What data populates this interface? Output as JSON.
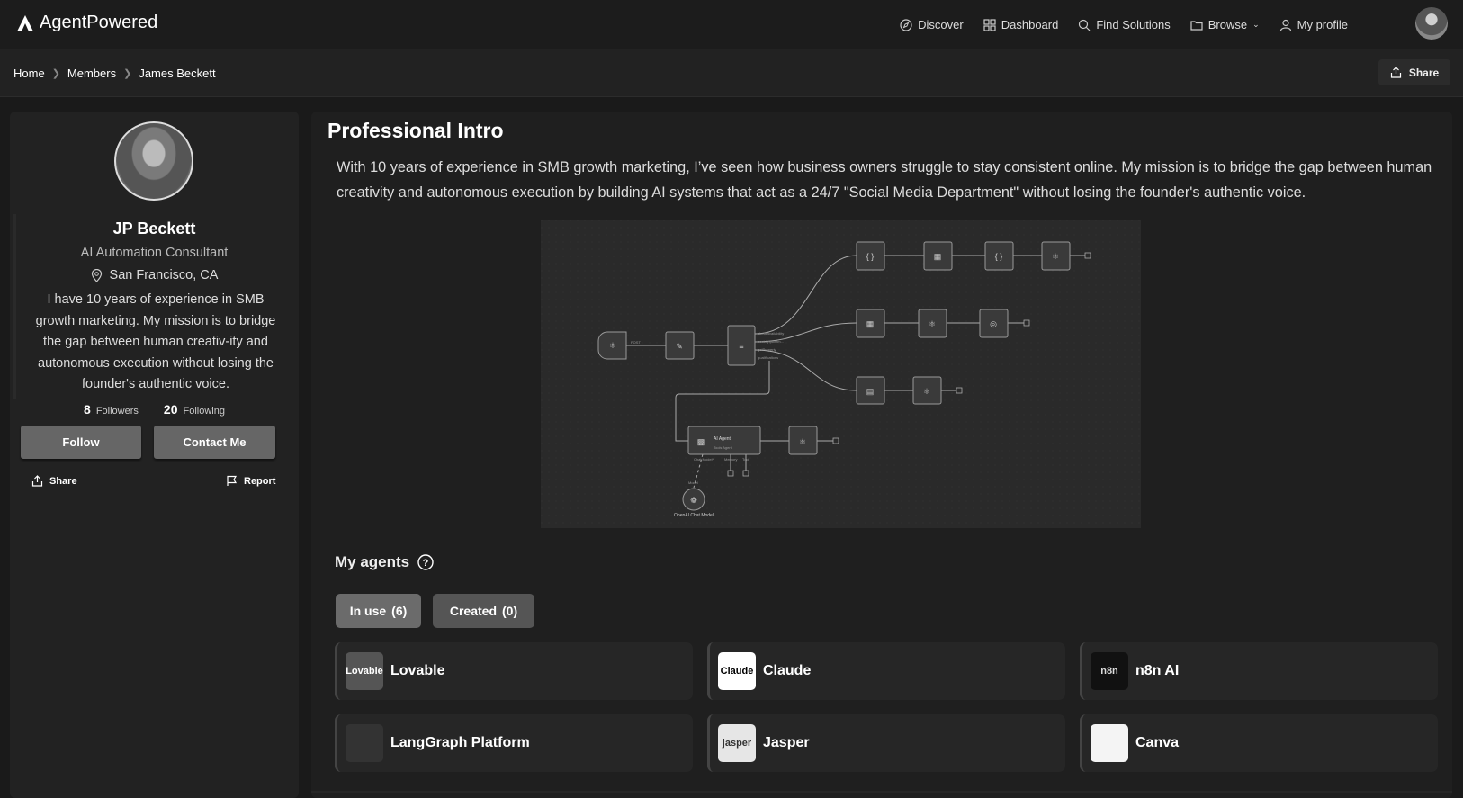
{
  "header": {
    "brand": "AgentPowered",
    "nav": [
      {
        "label": "Discover",
        "icon": "compass-icon"
      },
      {
        "label": "Dashboard",
        "icon": "grid-icon"
      },
      {
        "label": "Find Solutions",
        "icon": "search-icon"
      },
      {
        "label": "Browse",
        "icon": "folder-icon"
      },
      {
        "label": "My profile",
        "icon": "user-icon"
      }
    ]
  },
  "breadcrumb": [
    "Home",
    "Members",
    "James Beckett"
  ],
  "share_label": "Share",
  "profile": {
    "name": "JP Beckett",
    "title": "AI Automation Consultant",
    "location": "San Francisco, CA",
    "bio": "I have 10 years of experience in SMB growth marketing. My mission is to bridge the gap between human creativ-ity and autonomous execution without losing the founder's authentic voice.",
    "followers": "8",
    "followers_label": "Followers",
    "following": "20",
    "following_label": "Following",
    "follow_label": "Follow",
    "contact_label": "Contact Me",
    "share_label": "Share",
    "report_label": "Report"
  },
  "main": {
    "title": "Professional Intro",
    "intro": "With 10 years of experience in SMB growth marketing, I’ve seen how business owners struggle to stay consistent online. My mission is to bridge the gap between human creativity and autonomous execution by building AI systems that act as a 24/7 \"Social Media Department\" without losing the founder's authentic voice.",
    "workflow": {
      "trigger_label": "POST",
      "switch_outputs": [
        "checkAvailability",
        "bookAppointm...",
        "getProperty",
        "qualifications"
      ],
      "agent_title": "AI Agent",
      "agent_subtitle": "Tools Agent",
      "agent_inputs": [
        "Chat Model*",
        "Memory",
        "Tool"
      ],
      "model_label": "Model",
      "model_name": "OpenAI Chat Model"
    },
    "agents_heading": "My agents",
    "tabs": [
      {
        "label": "In use",
        "count": "(6)",
        "active": true
      },
      {
        "label": "Created",
        "count": "(0)",
        "active": false
      }
    ],
    "agents": [
      {
        "name": "Lovable",
        "logo_text": "Lovable",
        "logo_bg": "#555555",
        "logo_fg": "#ffffff"
      },
      {
        "name": "Claude",
        "logo_text": "Claude",
        "logo_bg": "#ffffff",
        "logo_fg": "#000000"
      },
      {
        "name": "n8n AI",
        "logo_text": "n8n",
        "logo_bg": "#111111",
        "logo_fg": "#dddddd"
      },
      {
        "name": "LangGraph Platform",
        "logo_text": "",
        "logo_bg": "#333333",
        "logo_fg": "#aaaaaa"
      },
      {
        "name": "Jasper",
        "logo_text": "jasper",
        "logo_bg": "#e6e6e6",
        "logo_fg": "#333333"
      },
      {
        "name": "Canva",
        "logo_text": "",
        "logo_bg": "#f4f4f4",
        "logo_fg": "#222222"
      }
    ]
  }
}
